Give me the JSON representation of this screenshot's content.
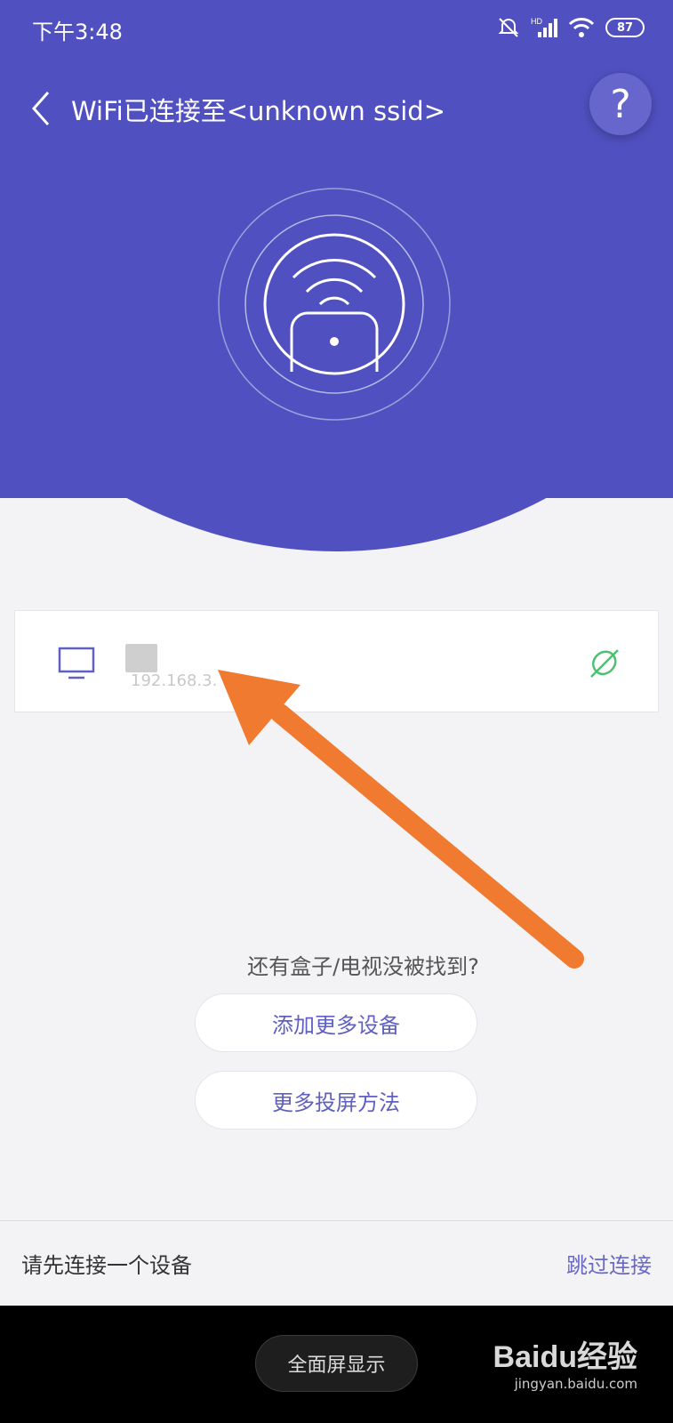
{
  "status_bar": {
    "time": "下午3:48",
    "hd_label": "HD",
    "battery": "87"
  },
  "header": {
    "title": "WiFi已连接至<unknown ssid>",
    "help_label": "?"
  },
  "device": {
    "ip": "192.168.3."
  },
  "prompt": {
    "text": "还有盒子/电视没被找到?",
    "add_button": "添加更多设备",
    "methods_button": "更多投屏方法"
  },
  "bottom_bar": {
    "hint": "请先连接一个设备",
    "skip": "跳过连接"
  },
  "nav": {
    "fullscreen": "全面屏显示"
  },
  "watermark": {
    "main": "Baidu经验",
    "sub": "jingyan.baidu.com"
  },
  "colors": {
    "header_bg": "#5050c0",
    "accent": "#6060c0",
    "link_green": "#4cc070",
    "annotation_arrow": "#f07a30"
  }
}
